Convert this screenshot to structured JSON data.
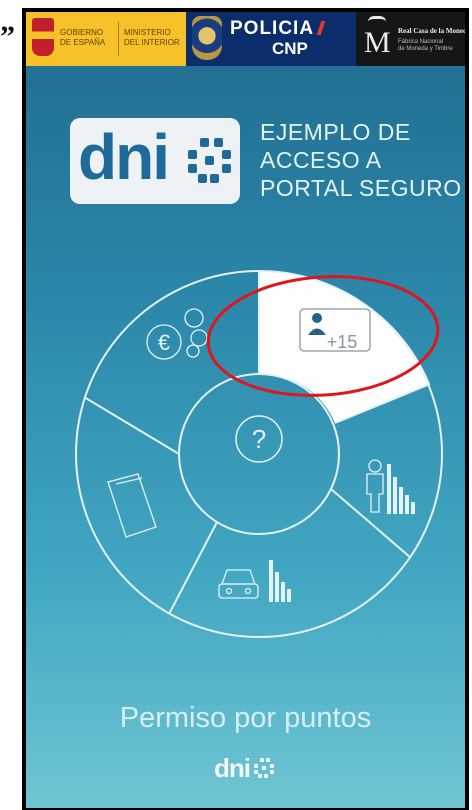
{
  "outside_mark": "”",
  "gov_bar": {
    "gobierno": "GOBIERNO\nDE ESPAÑA",
    "ministerio": "MINISTERIO\nDEL INTERIOR",
    "policia": "POLICIA",
    "cnp": "CNP",
    "fnmt_letter": "M",
    "fnmt_title": "Real Casa de la Moneda",
    "fnmt_sub": "Fábrica Nacional\nde Moneda y Timbre"
  },
  "brand": {
    "logo_text": "dni",
    "header_lines": [
      "EJEMPLO DE",
      "ACCESO A",
      "PORTAL SEGURO"
    ]
  },
  "wheel": {
    "center_symbol": "?",
    "segments": [
      {
        "id": "edad",
        "label": "+15",
        "icon": "person-card-icon",
        "active": true
      },
      {
        "id": "altura",
        "icon": "person-bars-icon",
        "active": false
      },
      {
        "id": "vehiculo",
        "icon": "car-bars-icon",
        "active": false
      },
      {
        "id": "documento",
        "icon": "document-icon",
        "active": false
      },
      {
        "id": "euro",
        "icon": "euro-coins-icon",
        "active": false
      }
    ]
  },
  "caption": "Permiso por puntos",
  "footer_logo": "dni",
  "colors": {
    "accent_circle": "#e0141b",
    "active_segment": "#ffffff",
    "line": "#e3f2f6"
  }
}
